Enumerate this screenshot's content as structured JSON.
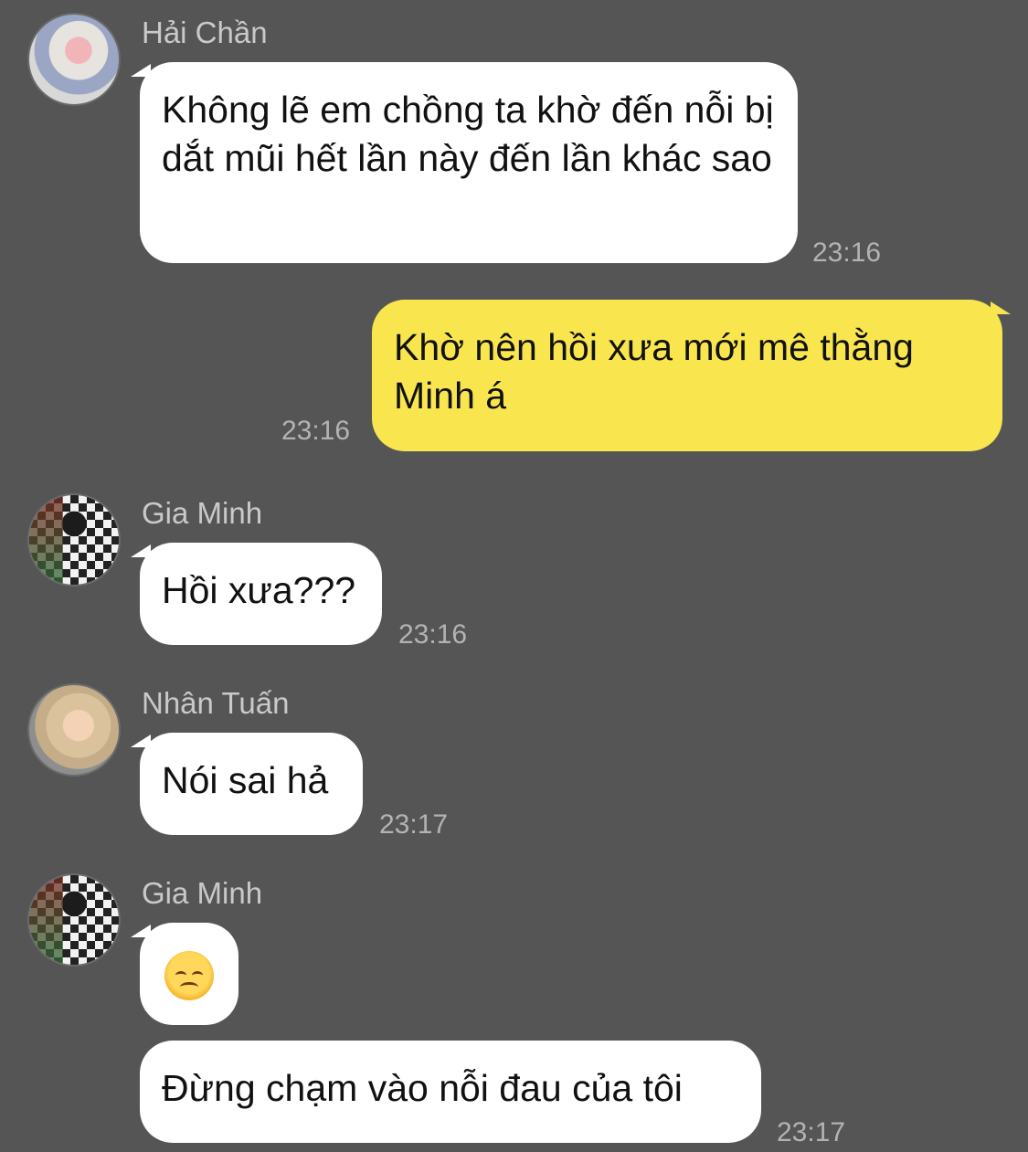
{
  "messages": [
    {
      "sender": "Hải Chần",
      "text": "Không lẽ em chồng ta khờ đến nỗi bị dắt mũi hết lần này đến lần khác sao",
      "time": "23:16"
    },
    {
      "sender": "",
      "text": "Khờ nên hồi xưa mới mê thằng Minh á",
      "time": "23:16"
    },
    {
      "sender": "Gia Minh",
      "text": "Hồi xưa???",
      "time": "23:16"
    },
    {
      "sender": "Nhân Tuấn",
      "text": "Nói sai hả",
      "time": "23:17"
    },
    {
      "sender": "Gia Minh",
      "emoji": "disappointed-face-emoji"
    },
    {
      "text": "Đừng chạm vào nỗi đau của tôi",
      "time": "23:17"
    }
  ],
  "colors": {
    "background": "#555555",
    "incoming_bubble": "#ffffff",
    "outgoing_bubble": "#f9e64f"
  }
}
